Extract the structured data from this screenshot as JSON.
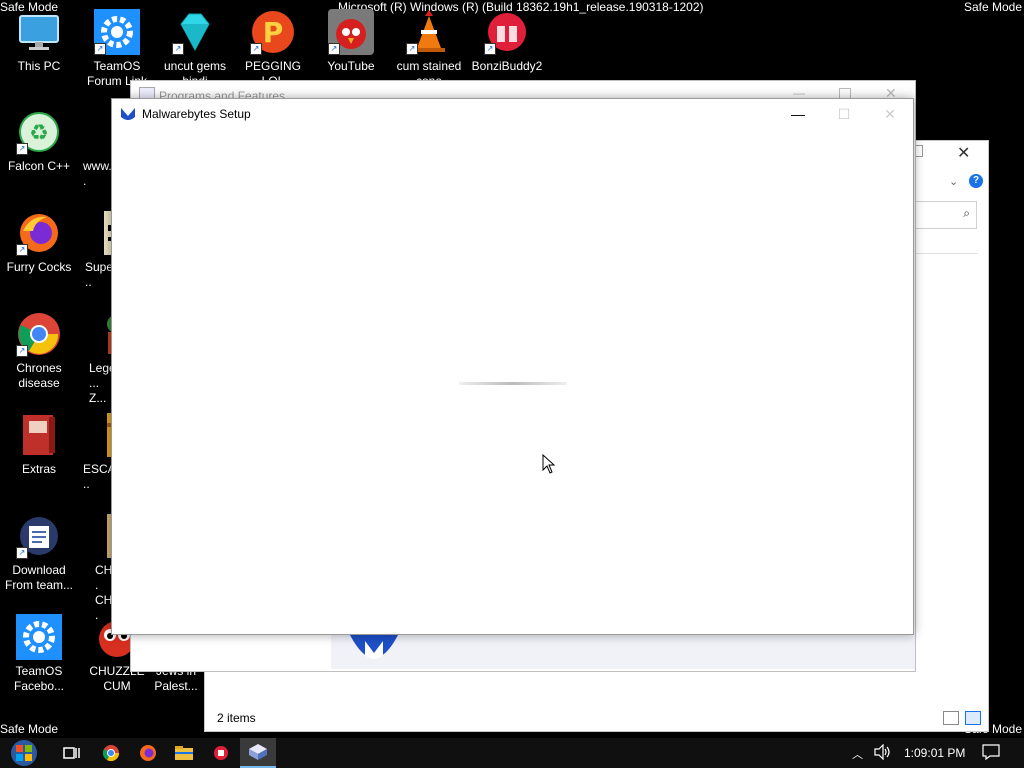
{
  "desktop": {
    "safe_mode_tl": "Safe Mode",
    "safe_mode_tr": "Safe Mode",
    "safe_mode_bl": "Safe Mode",
    "safe_mode_br": "Safe Mode",
    "build": "Microsoft (R) Windows (R) (Build 18362.19h1_release.190318-1202)",
    "icons": [
      {
        "label": "This PC",
        "icon": "monitor-icon",
        "color": "#3aa0e0"
      },
      {
        "label": "TeamOS Forum Link",
        "icon": "gear-icon",
        "color": "#1e90ff"
      },
      {
        "label": "uncut gems hindi",
        "icon": "gem-icon",
        "color": "#2fd6e6"
      },
      {
        "label": "PEGGING LOL",
        "icon": "p-logo-icon",
        "color": "#e8481c"
      },
      {
        "label": "YouTube",
        "icon": "angry-bird-icon",
        "color": "#d62020"
      },
      {
        "label": "cum stained cone",
        "icon": "traffic-cone-icon",
        "color": "#f07a10"
      },
      {
        "label": "BonziBuddy2",
        "icon": "gift-icon",
        "color": "#e0203a"
      },
      {
        "label": "Falcon C++",
        "icon": "recycle-icon",
        "color": "#2aa84a"
      },
      {
        "label": "www....",
        "icon": "document-icon",
        "color": "#555555"
      },
      {
        "label": "Furry Cocks",
        "icon": "firefox-icon",
        "color": "#f46a1a"
      },
      {
        "label": "Supe...",
        "icon": "pixel-game-icon",
        "color": "#e8e0c0"
      },
      {
        "label": "Chrones disease",
        "icon": "chrome-icon",
        "color": "#3a8ee6"
      },
      {
        "label": "Lege... Z...",
        "icon": "character-icon",
        "color": "#6a4a2a"
      },
      {
        "label": "Extras",
        "icon": "book-icon",
        "color": "#c0302a"
      },
      {
        "label": "ESCA...",
        "icon": "archive-icon",
        "color": "#e0a020"
      },
      {
        "label": "Download From team...",
        "icon": "notepad-icon",
        "color": "#4a6ab0"
      },
      {
        "label": "CH... CH...",
        "icon": "game-box-icon",
        "color": "#d0b070"
      },
      {
        "label": "TeamOS Facebo...",
        "icon": "gear-icon",
        "color": "#1e90ff"
      },
      {
        "label": "CHUZZLE CUM",
        "icon": "chuzzle-icon",
        "color": "#d83020"
      },
      {
        "label": "Jews in Palest...",
        "icon": "document-icon",
        "color": "#000000"
      }
    ]
  },
  "programs_window": {
    "title": "Programs and Features"
  },
  "explorer_window": {
    "status": "2 items"
  },
  "setup_window": {
    "title": "Malwarebytes Setup",
    "minimize": "—",
    "maximize": "☐",
    "close": "✕"
  },
  "taskbar": {
    "clock": "1:09:01 PM",
    "items": [
      "start-icon",
      "task-view-icon",
      "chrome-icon",
      "firefox-icon",
      "file-explorer-icon",
      "bonzi-icon",
      "malwarebytes-setup-icon"
    ]
  }
}
